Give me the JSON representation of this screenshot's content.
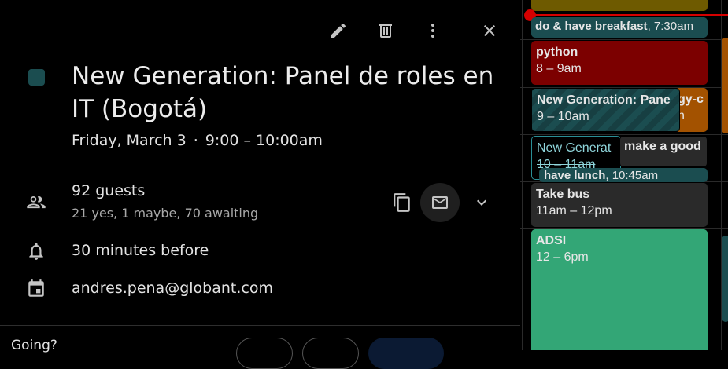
{
  "toolbar": {
    "edit_icon": "pencil-icon",
    "delete_icon": "trash-icon",
    "more_icon": "more-vert-icon",
    "close_icon": "close-icon"
  },
  "event": {
    "color": "#1b4d50",
    "title": "New Generation: Panel de roles en IT (Bogotá)",
    "date": "Friday, March 3",
    "separator": "·",
    "time": "9:00 – 10:00am"
  },
  "guests": {
    "count_label": "92 guests",
    "summary": "21 yes, 1 maybe, 70 awaiting",
    "copy_icon": "copy-icon",
    "email_icon": "mail-icon",
    "expand_icon": "chevron-down-icon"
  },
  "reminder": {
    "label": "30 minutes before",
    "icon": "bell-icon"
  },
  "calendar_owner": {
    "label": "andres.pena@globant.com",
    "icon": "calendar-icon"
  },
  "rsvp": {
    "label": "Going?"
  },
  "day_view": {
    "colors": {
      "now_line": "#d50000",
      "tomato": "#7c0000",
      "teal": "#1b4d50",
      "graphite": "#2a2a2a",
      "sage": "#33a676",
      "tangerine": "#a35200",
      "banana": "#6e5a00"
    },
    "events": [
      {
        "title": "do & have breakfast",
        "time": "7:30am"
      },
      {
        "title": "python",
        "time": "8 – 9am"
      },
      {
        "title": "New Generation: Pane",
        "time": "9 – 10am"
      },
      {
        "title": "gy-c",
        "time": "n"
      },
      {
        "title": "New Generat",
        "time": "10 – 11am"
      },
      {
        "title": "make a good"
      },
      {
        "title": "have lunch",
        "time": "10:45am"
      },
      {
        "title": "Take bus",
        "time": "11am – 12pm"
      },
      {
        "title": "ADSI",
        "time": "12 – 6pm"
      }
    ]
  }
}
